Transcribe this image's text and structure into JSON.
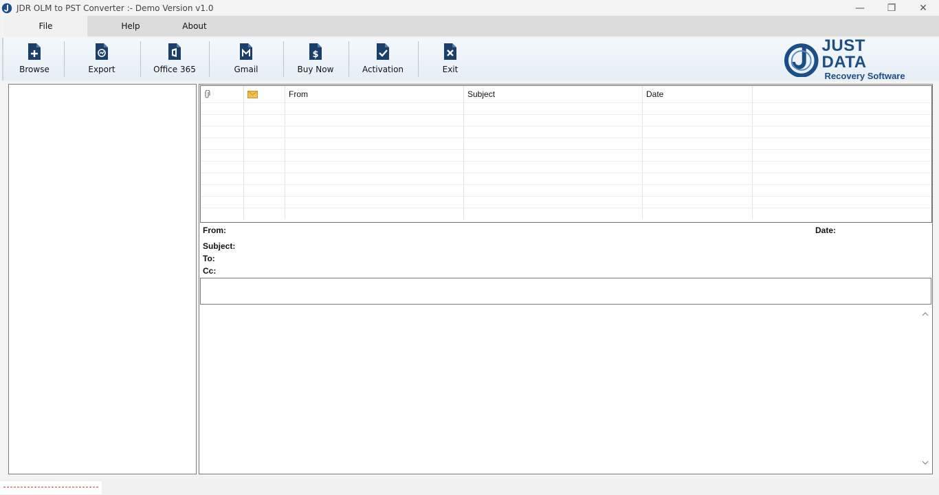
{
  "window": {
    "title": "JDR OLM to PST Converter :- Demo Version v1.0",
    "minimize_glyph": "—",
    "maximize_glyph": "❐",
    "close_glyph": "✕"
  },
  "menu": {
    "items": [
      {
        "label": "File"
      },
      {
        "label": "Help"
      },
      {
        "label": "About"
      }
    ]
  },
  "toolbar": {
    "items": [
      {
        "label": "Browse",
        "icon": "file-plus-icon"
      },
      {
        "label": "Export",
        "icon": "file-export-icon"
      },
      {
        "label": "Office 365",
        "icon": "office365-icon"
      },
      {
        "label": "Gmail",
        "icon": "gmail-icon"
      },
      {
        "label": "Buy Now",
        "icon": "dollar-icon"
      },
      {
        "label": "Activation",
        "icon": "check-icon"
      },
      {
        "label": "Exit",
        "icon": "close-icon"
      }
    ],
    "icon_color": "#1b3f6b"
  },
  "logo": {
    "title": "JUST DATA",
    "subtitle": "Recovery Software",
    "color": "#1b4d86"
  },
  "grid": {
    "columns": [
      {
        "label": "",
        "icon": "paperclip-icon"
      },
      {
        "label": "",
        "icon": "envelope-icon"
      },
      {
        "label": "From"
      },
      {
        "label": "Subject"
      },
      {
        "label": "Date"
      },
      {
        "label": ""
      }
    ]
  },
  "message_meta": {
    "from_label": "From:",
    "date_label": "Date:",
    "subject_label": "Subject:",
    "to_label": "To:",
    "cc_label": "Cc:"
  },
  "status": {
    "dash_color": "#e53a3a"
  }
}
